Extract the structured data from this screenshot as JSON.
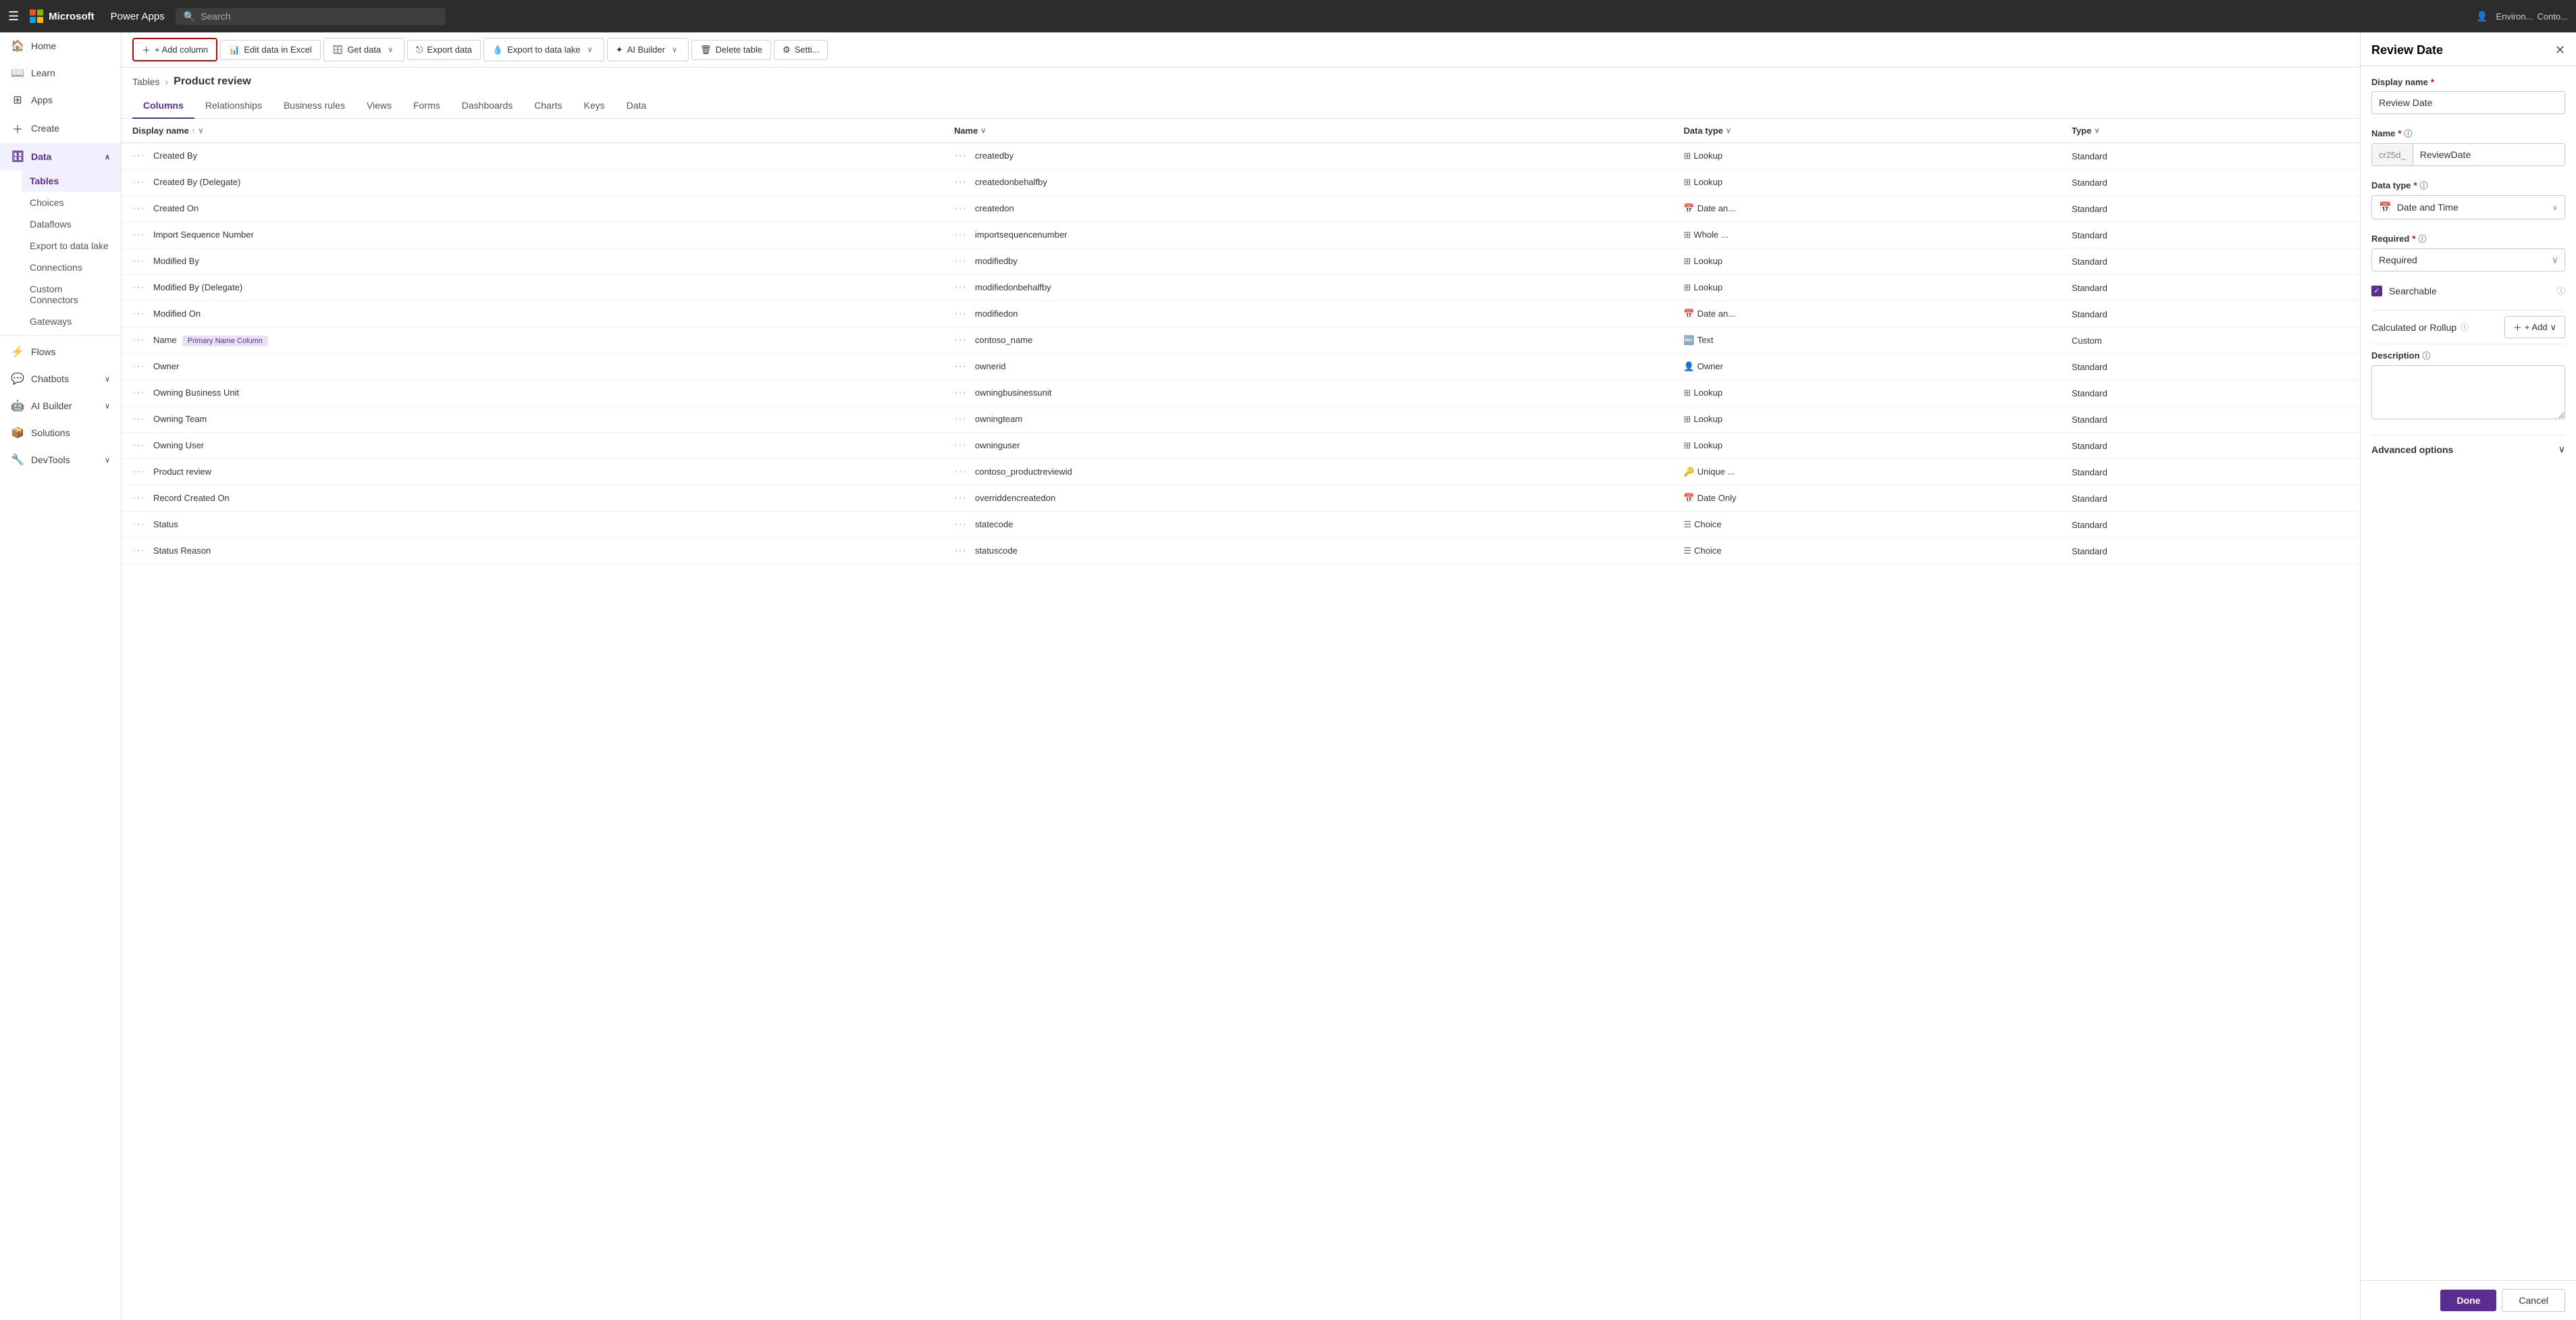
{
  "topNav": {
    "brand": "Microsoft",
    "appName": "Power Apps",
    "searchPlaceholder": "Search",
    "envLabel": "Environ...",
    "envSub": "Conto..."
  },
  "sidebar": {
    "items": [
      {
        "id": "home",
        "label": "Home",
        "icon": "🏠",
        "active": false
      },
      {
        "id": "learn",
        "label": "Learn",
        "icon": "📖",
        "active": false
      },
      {
        "id": "apps",
        "label": "Apps",
        "icon": "⊞",
        "active": false
      },
      {
        "id": "create",
        "label": "Create",
        "icon": "+",
        "active": false
      },
      {
        "id": "data",
        "label": "Data",
        "icon": "🗄",
        "active": true,
        "expanded": true
      }
    ],
    "dataSubItems": [
      {
        "id": "tables",
        "label": "Tables",
        "active": true
      },
      {
        "id": "choices",
        "label": "Choices",
        "active": false
      },
      {
        "id": "dataflows",
        "label": "Dataflows",
        "active": false
      },
      {
        "id": "exportdatalake",
        "label": "Export to data lake",
        "active": false
      },
      {
        "id": "connections",
        "label": "Connections",
        "active": false
      },
      {
        "id": "customconnectors",
        "label": "Custom Connectors",
        "active": false
      },
      {
        "id": "gateways",
        "label": "Gateways",
        "active": false
      }
    ],
    "moreItems": [
      {
        "id": "flows",
        "label": "Flows",
        "icon": "⚡",
        "active": false
      },
      {
        "id": "chatbots",
        "label": "Chatbots",
        "icon": "💬",
        "active": false,
        "hasChevron": true
      },
      {
        "id": "aibuilder",
        "label": "AI Builder",
        "icon": "🤖",
        "active": false,
        "hasChevron": true
      },
      {
        "id": "solutions",
        "label": "Solutions",
        "icon": "📦",
        "active": false
      },
      {
        "id": "devtools",
        "label": "DevTools",
        "icon": "🔧",
        "active": false,
        "hasChevron": true
      }
    ]
  },
  "toolbar": {
    "addColumnLabel": "+ Add column",
    "editDataLabel": "Edit data in Excel",
    "getDataLabel": "Get data",
    "exportDataLabel": "Export data",
    "exportDataLakeLabel": "Export to data lake",
    "aiBuilderLabel": "AI Builder",
    "deleteTableLabel": "Delete table",
    "settingsLabel": "Setti..."
  },
  "breadcrumb": {
    "root": "Tables",
    "current": "Product review"
  },
  "tabs": [
    {
      "id": "columns",
      "label": "Columns",
      "active": true
    },
    {
      "id": "relationships",
      "label": "Relationships",
      "active": false
    },
    {
      "id": "businessrules",
      "label": "Business rules",
      "active": false
    },
    {
      "id": "views",
      "label": "Views",
      "active": false
    },
    {
      "id": "forms",
      "label": "Forms",
      "active": false
    },
    {
      "id": "dashboards",
      "label": "Dashboards",
      "active": false
    },
    {
      "id": "charts",
      "label": "Charts",
      "active": false
    },
    {
      "id": "keys",
      "label": "Keys",
      "active": false
    },
    {
      "id": "data",
      "label": "Data",
      "active": false
    }
  ],
  "tableHeaders": [
    {
      "id": "displayname",
      "label": "Display name",
      "sortable": true,
      "sorted": "asc",
      "filter": true
    },
    {
      "id": "name",
      "label": "Name",
      "sortable": true,
      "sorted": null,
      "filter": true
    },
    {
      "id": "datatype",
      "label": "Data type",
      "sortable": true,
      "sorted": null,
      "filter": true
    },
    {
      "id": "type",
      "label": "Type",
      "sortable": true,
      "sorted": null,
      "filter": true
    }
  ],
  "tableRows": [
    {
      "displayName": "Created By",
      "name": "createdby",
      "dataType": "Lookup",
      "type": "Standard",
      "dataTypeIcon": "⊞"
    },
    {
      "displayName": "Created By (Delegate)",
      "name": "createdonbehalfby",
      "dataType": "Lookup",
      "type": "Standard",
      "dataTypeIcon": "⊞"
    },
    {
      "displayName": "Created On",
      "name": "createdon",
      "dataType": "Date an...",
      "type": "Standard",
      "dataTypeIcon": "📅"
    },
    {
      "displayName": "Import Sequence Number",
      "name": "importsequencenumber",
      "dataType": "Whole ...",
      "type": "Standard",
      "dataTypeIcon": "⊞"
    },
    {
      "displayName": "Modified By",
      "name": "modifiedby",
      "dataType": "Lookup",
      "type": "Standard",
      "dataTypeIcon": "⊞"
    },
    {
      "displayName": "Modified By (Delegate)",
      "name": "modifiedonbehalfby",
      "dataType": "Lookup",
      "type": "Standard",
      "dataTypeIcon": "⊞"
    },
    {
      "displayName": "Modified On",
      "name": "modifiedon",
      "dataType": "Date an...",
      "type": "Standard",
      "dataTypeIcon": "📅"
    },
    {
      "displayName": "Name",
      "name": "contoso_name",
      "dataType": "Text",
      "type": "Custom",
      "badge": "Primary Name Column",
      "dataTypeIcon": "🔤"
    },
    {
      "displayName": "Owner",
      "name": "ownerid",
      "dataType": "Owner",
      "type": "Standard",
      "dataTypeIcon": "👤"
    },
    {
      "displayName": "Owning Business Unit",
      "name": "owningbusinessunit",
      "dataType": "Lookup",
      "type": "Standard",
      "dataTypeIcon": "⊞"
    },
    {
      "displayName": "Owning Team",
      "name": "owningteam",
      "dataType": "Lookup",
      "type": "Standard",
      "dataTypeIcon": "⊞"
    },
    {
      "displayName": "Owning User",
      "name": "owninguser",
      "dataType": "Lookup",
      "type": "Standard",
      "dataTypeIcon": "⊞"
    },
    {
      "displayName": "Product review",
      "name": "contoso_productreviewid",
      "dataType": "Unique ...",
      "type": "Standard",
      "dataTypeIcon": "🔑"
    },
    {
      "displayName": "Record Created On",
      "name": "overriddencreatedon",
      "dataType": "Date Only",
      "type": "Standard",
      "dataTypeIcon": "📅"
    },
    {
      "displayName": "Status",
      "name": "statecode",
      "dataType": "Choice",
      "type": "Standard",
      "dataTypeIcon": "☰"
    },
    {
      "displayName": "Status Reason",
      "name": "statuscode",
      "dataType": "Choice",
      "type": "Standard",
      "dataTypeIcon": "☰"
    }
  ],
  "rightPanel": {
    "title": "Review Date",
    "displayNameLabel": "Display name",
    "displayNameValue": "Review Date",
    "nameLabel": "Name",
    "namePrefix": "cr25d_",
    "nameValue": "ReviewDate",
    "dataTypeLabel": "Data type",
    "dataTypeIcon": "📅",
    "dataTypeValue": "Date and Time",
    "requiredLabel": "Required",
    "requiredValue": "Required",
    "searchableLabel": "Searchable",
    "searchableChecked": true,
    "calcRollupLabel": "Calculated or Rollup",
    "addLabel": "+ Add",
    "descriptionLabel": "Description",
    "descriptionPlaceholder": "",
    "advancedOptionsLabel": "Advanced options",
    "doneLabel": "Done",
    "cancelLabel": "Cancel"
  }
}
